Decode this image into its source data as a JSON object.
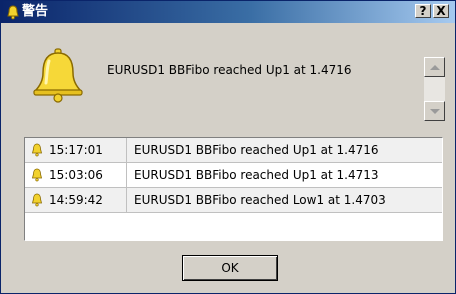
{
  "window": {
    "title": "警告",
    "help_label": "?",
    "close_label": "X"
  },
  "alert": {
    "message": "EURUSD1 BBFibo reached Up1 at 1.4716"
  },
  "rows": [
    {
      "time": "15:17:01",
      "message": "EURUSD1 BBFibo reached Up1 at 1.4716"
    },
    {
      "time": "15:03:06",
      "message": "EURUSD1 BBFibo reached Up1 at 1.4713"
    },
    {
      "time": "14:59:42",
      "message": "EURUSD1 BBFibo reached Low1 at 1.4703"
    }
  ],
  "ok_label": "OK",
  "colors": {
    "bell": "#f2d22e",
    "bell_outline": "#8a6a00",
    "titlebar": "#0a246a"
  }
}
